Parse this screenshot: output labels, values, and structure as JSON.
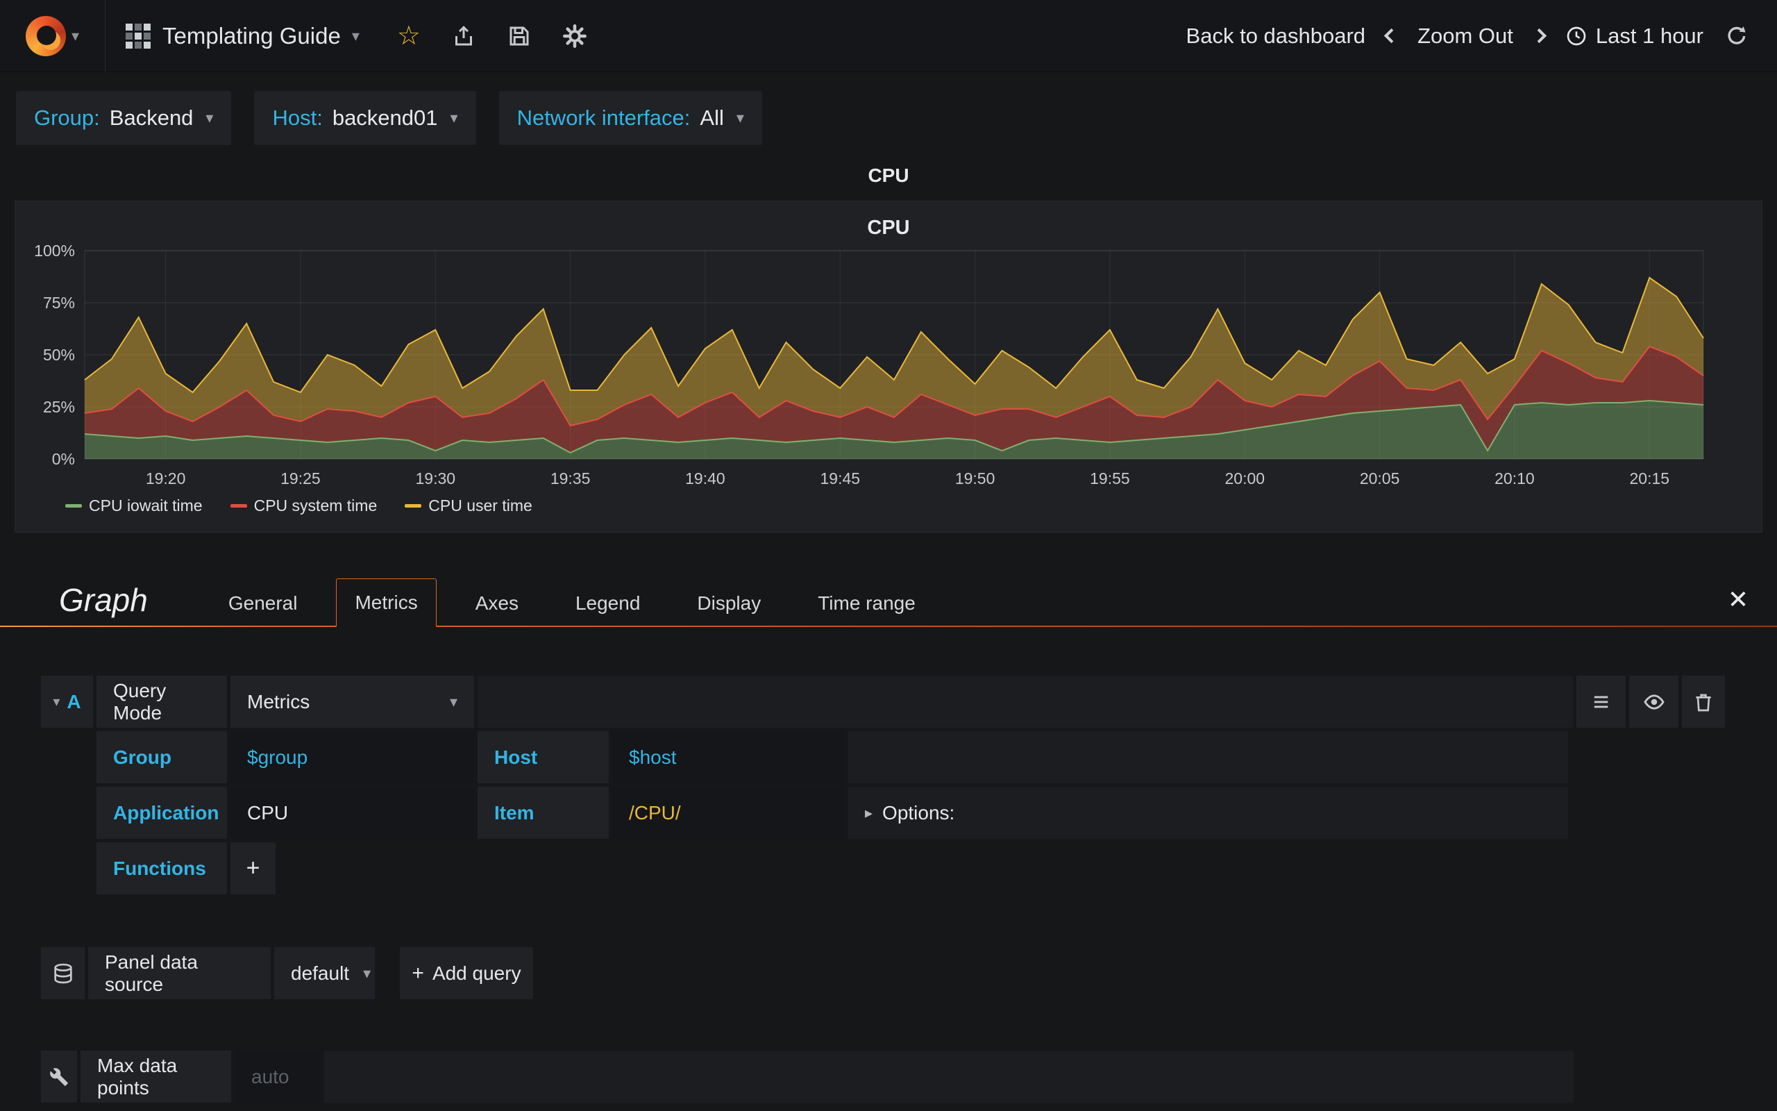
{
  "navbar": {
    "title": "Templating Guide",
    "back_to_dashboard": "Back to dashboard",
    "zoom_out": "Zoom Out",
    "time_range": "Last 1 hour"
  },
  "variables": {
    "group": {
      "label": "Group:",
      "value": "Backend"
    },
    "host": {
      "label": "Host:",
      "value": "backend01"
    },
    "network_interface": {
      "label": "Network interface:",
      "value": "All"
    }
  },
  "panel": {
    "title": "CPU",
    "chart_title": "CPU"
  },
  "chart_data": {
    "type": "area",
    "stacked": true,
    "title": "CPU",
    "xlabel": "",
    "ylabel": "",
    "unit": "percent",
    "ylim": [
      0,
      100
    ],
    "grid": true,
    "legend_position": "bottom-left",
    "x_start": "19:17",
    "x_step_minutes": 1,
    "x_ticks": [
      "19:20",
      "19:25",
      "19:30",
      "19:35",
      "19:40",
      "19:45",
      "19:50",
      "19:55",
      "20:00",
      "20:05",
      "20:10",
      "20:15"
    ],
    "y_ticks": [
      "0%",
      "25%",
      "50%",
      "75%",
      "100%"
    ],
    "series": [
      {
        "name": "CPU iowait time",
        "color": "#7EB26D",
        "values": [
          12,
          11,
          10,
          11,
          9,
          10,
          11,
          10,
          9,
          8,
          9,
          10,
          9,
          4,
          9,
          8,
          9,
          10,
          3,
          9,
          10,
          9,
          8,
          9,
          10,
          9,
          8,
          9,
          10,
          9,
          8,
          9,
          10,
          9,
          4,
          9,
          10,
          9,
          8,
          9,
          10,
          11,
          12,
          14,
          16,
          18,
          20,
          22,
          23,
          24,
          25,
          26,
          4,
          26,
          27,
          26,
          27,
          27,
          28,
          27,
          26
        ]
      },
      {
        "name": "CPU system time",
        "color": "#E24D42",
        "values": [
          10,
          13,
          24,
          12,
          9,
          15,
          22,
          11,
          9,
          16,
          14,
          10,
          18,
          26,
          11,
          14,
          20,
          28,
          13,
          10,
          16,
          22,
          12,
          18,
          22,
          11,
          20,
          14,
          10,
          16,
          12,
          22,
          16,
          12,
          20,
          15,
          10,
          16,
          22,
          12,
          10,
          14,
          26,
          14,
          9,
          13,
          10,
          18,
          24,
          10,
          8,
          12,
          15,
          9,
          25,
          20,
          12,
          10,
          26,
          22,
          14
        ]
      },
      {
        "name": "CPU user time",
        "color": "#EAB839",
        "values": [
          16,
          24,
          34,
          18,
          14,
          22,
          32,
          16,
          14,
          26,
          22,
          15,
          28,
          32,
          14,
          20,
          30,
          34,
          17,
          14,
          24,
          32,
          15,
          26,
          30,
          14,
          28,
          20,
          14,
          24,
          18,
          30,
          22,
          15,
          28,
          20,
          14,
          24,
          32,
          17,
          14,
          24,
          34,
          18,
          13,
          21,
          15,
          27,
          33,
          14,
          12,
          18,
          22,
          13,
          32,
          28,
          17,
          14,
          33,
          29,
          18
        ]
      }
    ]
  },
  "editor": {
    "panel_type_title": "Graph",
    "tabs": [
      "General",
      "Metrics",
      "Axes",
      "Legend",
      "Display",
      "Time range"
    ],
    "active_tab": "Metrics",
    "query_row": {
      "ref": "A",
      "mode_label": "Query Mode",
      "mode_value": "Metrics",
      "group_label": "Group",
      "group_value": "$group",
      "host_label": "Host",
      "host_value": "$host",
      "application_label": "Application",
      "application_value": "CPU",
      "item_label": "Item",
      "item_value": "/CPU/",
      "options_label": "Options:",
      "functions_label": "Functions",
      "add_function": "+"
    },
    "datasource": {
      "label": "Panel data source",
      "value": "default",
      "add_query_label": "Add query"
    },
    "metrics_options": {
      "max_data_points_label": "Max data points",
      "max_data_points_placeholder": "auto"
    }
  },
  "colors": {
    "accent_cyan": "#33b5e5",
    "highlight_orange": "#d96a1e",
    "star_yellow": "#eab839"
  },
  "glyphs": {
    "caret_down": "▾",
    "caret_right": "▸",
    "star": "☆",
    "hamburger": "≡",
    "plus": "+"
  }
}
